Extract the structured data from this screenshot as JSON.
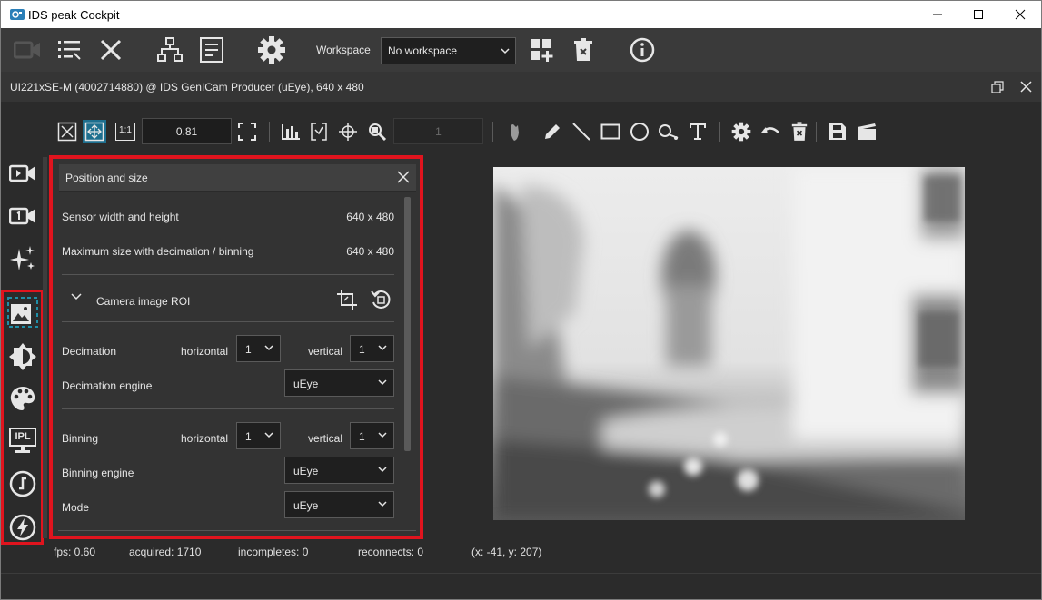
{
  "window": {
    "title": "IDS peak Cockpit"
  },
  "toolbar": {
    "workspace_label": "Workspace",
    "workspace_value": "No workspace"
  },
  "camera": {
    "header": "UI221xSE-M (4002714880) @ IDS GenICam Producer (uEye), 640 x 480"
  },
  "view_toolbar": {
    "zoom_value": "0.81",
    "page_value": "1",
    "one_to_one_label": "1:1"
  },
  "panel": {
    "title": "Position and size",
    "sensor_label": "Sensor width and height",
    "sensor_value": "640 x 480",
    "maxsize_label": "Maximum size with decimation / binning",
    "maxsize_value": "640 x 480",
    "roi_label": "Camera image ROI",
    "decimation_label": "Decimation",
    "decimation_horizontal_label": "horizontal",
    "decimation_horizontal_value": "1",
    "decimation_vertical_label": "vertical",
    "decimation_vertical_value": "1",
    "decimation_engine_label": "Decimation engine",
    "decimation_engine_value": "uEye",
    "binning_label": "Binning",
    "binning_horizontal_label": "horizontal",
    "binning_horizontal_value": "1",
    "binning_vertical_label": "vertical",
    "binning_vertical_value": "1",
    "binning_engine_label": "Binning engine",
    "binning_engine_value": "uEye",
    "mode_label": "Mode",
    "mode_value": "uEye"
  },
  "sidebar": {
    "ipl_label": "IPL"
  },
  "status": {
    "fps": "fps: 0.60",
    "acquired": "acquired: 1710",
    "incompletes": "incompletes: 0",
    "reconnects": "reconnects: 0",
    "coords": "(x: -41, y: 207)"
  },
  "colors": {
    "highlight": "#e0141e",
    "accent": "#1e6f8f"
  }
}
